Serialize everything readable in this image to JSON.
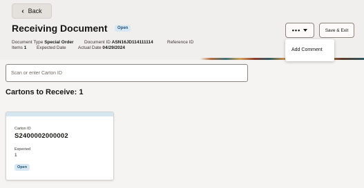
{
  "header": {
    "back_label": "Back",
    "title": "Receiving Document",
    "status": "Open",
    "meta": {
      "document_type_label": "Document Type",
      "document_type_value": "Special Order",
      "document_id_label": "Document ID",
      "document_id_value": "ASN16JD114111114",
      "reference_id_label": "Reference ID",
      "items_label": "Items",
      "items_value": "1",
      "expected_date_label": "Expected Date",
      "actual_date_label": "Actual Date",
      "actual_date_value": "04/29/2024"
    },
    "more_label": "•••",
    "save_exit_label": "Save & Exit"
  },
  "menu": {
    "items": [
      "Add Comment"
    ]
  },
  "search": {
    "placeholder": "Scan or enter Carton ID"
  },
  "cartons": {
    "title": "Cartons to Receive: 1",
    "items": [
      {
        "carton_id_label": "Carton ID",
        "carton_id": "S2400002000002",
        "expected_label": "Expected",
        "expected": "1",
        "status": "Open"
      }
    ]
  },
  "colors": {
    "background": "#f6f4f2",
    "status_pill_bg": "#d8e8f2",
    "status_pill_text": "#1f4e79",
    "card_top": "#d4e6ef"
  }
}
